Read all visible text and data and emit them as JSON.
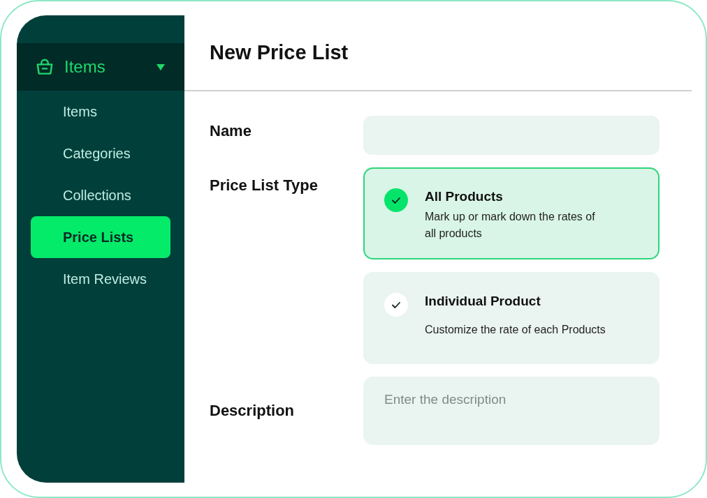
{
  "sidebar": {
    "section": {
      "label": "Items",
      "expanded": true
    },
    "items": [
      {
        "label": "Items",
        "selected": false
      },
      {
        "label": "Categories",
        "selected": false
      },
      {
        "label": "Collections",
        "selected": false
      },
      {
        "label": "Price Lists",
        "selected": true
      },
      {
        "label": "Item Reviews",
        "selected": false
      }
    ]
  },
  "form": {
    "title": "New Price List",
    "name": {
      "label": "Name"
    },
    "price_list_type": {
      "label": "Price List Type",
      "options": [
        {
          "title": "All Products",
          "description": "Mark up or mark down the rates of all products",
          "selected": true
        },
        {
          "title": "Individual Product",
          "description": "Customize the rate of each Products",
          "selected": false
        }
      ]
    },
    "description": {
      "label": "Description",
      "placeholder": "Enter the description"
    }
  }
}
